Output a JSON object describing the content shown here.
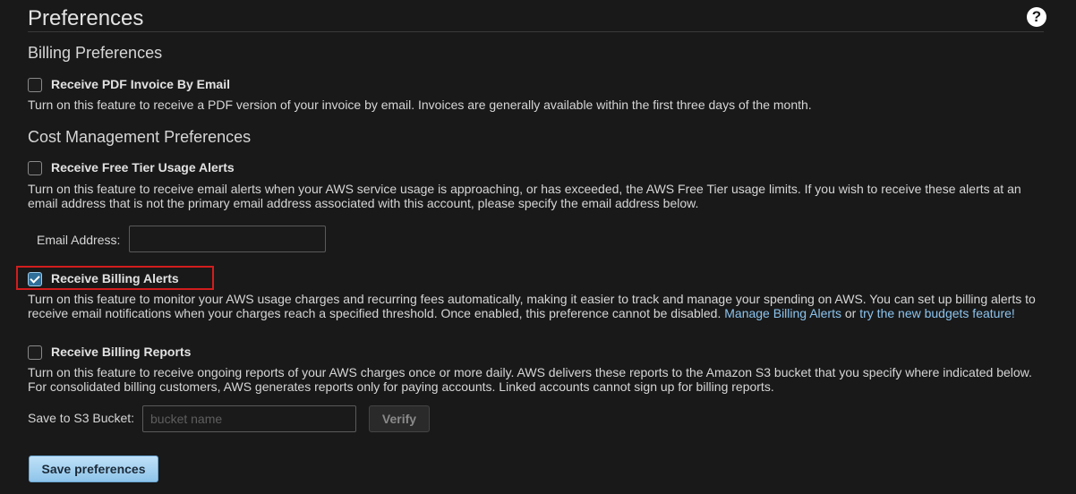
{
  "header": {
    "title": "Preferences",
    "help_icon": "help-circle-icon",
    "help_glyph": "?"
  },
  "billing_preferences": {
    "heading": "Billing Preferences",
    "pdf_invoice": {
      "label": "Receive PDF Invoice By Email",
      "checked": false,
      "description": "Turn on this feature to receive a PDF version of your invoice by email. Invoices are generally available within the first three days of the month."
    }
  },
  "cost_management": {
    "heading": "Cost Management Preferences",
    "free_tier": {
      "label": "Receive Free Tier Usage Alerts",
      "checked": false,
      "description": "Turn on this feature to receive email alerts when your AWS service usage is approaching, or has exceeded, the AWS Free Tier usage limits. If you wish to receive these alerts at an email address that is not the primary email address associated with this account, please specify the email address below.",
      "email_label": "Email Address:",
      "email_value": ""
    },
    "billing_alerts": {
      "label": "Receive Billing Alerts",
      "checked": true,
      "description": "Turn on this feature to monitor your AWS usage charges and recurring fees automatically, making it easier to track and manage your spending on AWS. You can set up billing alerts to receive email notifications when your charges reach a specified threshold. Once enabled, this preference cannot be disabled.",
      "manage_link": "Manage Billing Alerts",
      "or_text": "or",
      "budgets_link": "try the new budgets feature!"
    },
    "billing_reports": {
      "label": "Receive Billing Reports",
      "checked": false,
      "description": "Turn on this feature to receive ongoing reports of your AWS charges once or more daily. AWS delivers these reports to the Amazon S3 bucket that you specify where indicated below. For consolidated billing customers, AWS generates reports only for paying accounts. Linked accounts cannot sign up for billing reports.",
      "bucket_label": "Save to S3 Bucket:",
      "bucket_placeholder": "bucket name",
      "verify_label": "Verify"
    }
  },
  "actions": {
    "save_label": "Save preferences"
  },
  "colors": {
    "background": "#191919",
    "link": "#8cc4ee",
    "highlight": "#d21d1d",
    "save_button": "#a9d4f3"
  }
}
